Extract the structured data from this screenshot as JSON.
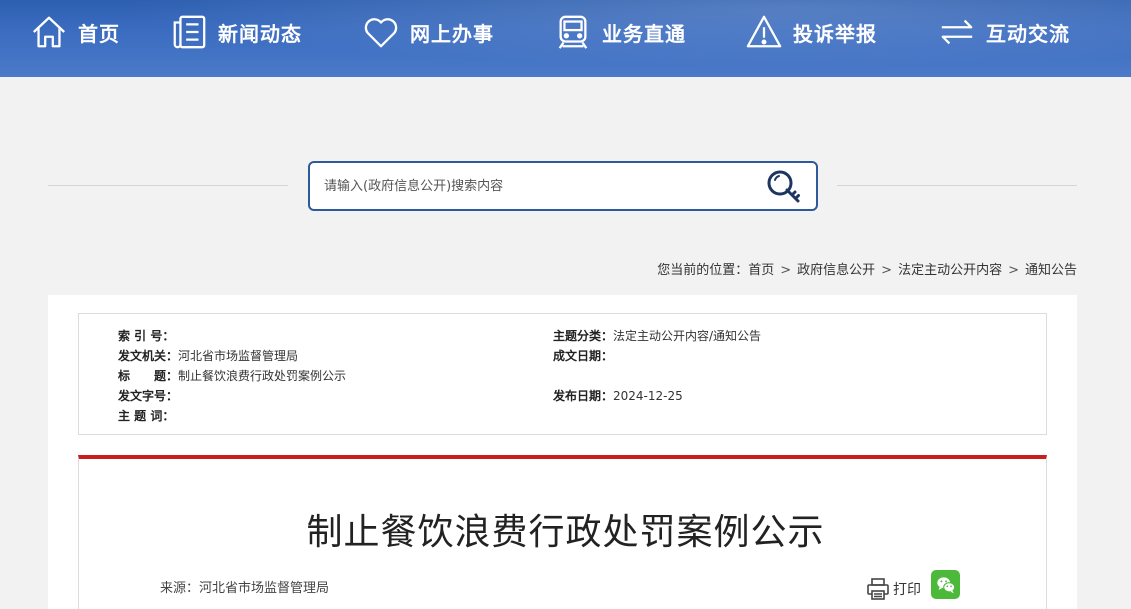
{
  "nav": {
    "items": [
      {
        "label": "首页",
        "icon": "home-icon"
      },
      {
        "label": "新闻动态",
        "icon": "news-icon"
      },
      {
        "label": "网上办事",
        "icon": "heart-icon"
      },
      {
        "label": "业务直通",
        "icon": "train-icon"
      },
      {
        "label": "投诉举报",
        "icon": "warning-icon"
      },
      {
        "label": "互动交流",
        "icon": "exchange-icon"
      }
    ]
  },
  "search": {
    "placeholder": "请输入(政府信息公开)搜索内容",
    "icon": "search-key-icon"
  },
  "breadcrumb": {
    "prefix": "您当前的位置：",
    "items": [
      "首页",
      "政府信息公开",
      "法定主动公开内容",
      "通知公告"
    ],
    "separator": ">"
  },
  "info": {
    "index_no": {
      "label": "索 引 号：",
      "value": ""
    },
    "issuer": {
      "label": "发文机关：",
      "value": "河北省市场监督管理局"
    },
    "title": {
      "label": "标　　题：",
      "value": "制止餐饮浪费行政处罚案例公示"
    },
    "doc_no": {
      "label": "发文字号：",
      "value": ""
    },
    "keywords": {
      "label": "主 题 词：",
      "value": ""
    },
    "category": {
      "label": "主题分类：",
      "value": "法定主动公开内容/通知公告"
    },
    "written_date": {
      "label": "成文日期：",
      "value": ""
    },
    "publish_date": {
      "label": "发布日期：",
      "value": "2024-12-25"
    }
  },
  "article": {
    "title": "制止餐饮浪费行政处罚案例公示",
    "source": "来源：河北省市场监督管理局",
    "print_label": "打印"
  },
  "colors": {
    "nav_bg": "#3b6cc0",
    "search_border": "#2d5a9a",
    "article_top_border": "#c81e1e",
    "wechat_green": "#4cb93a"
  }
}
